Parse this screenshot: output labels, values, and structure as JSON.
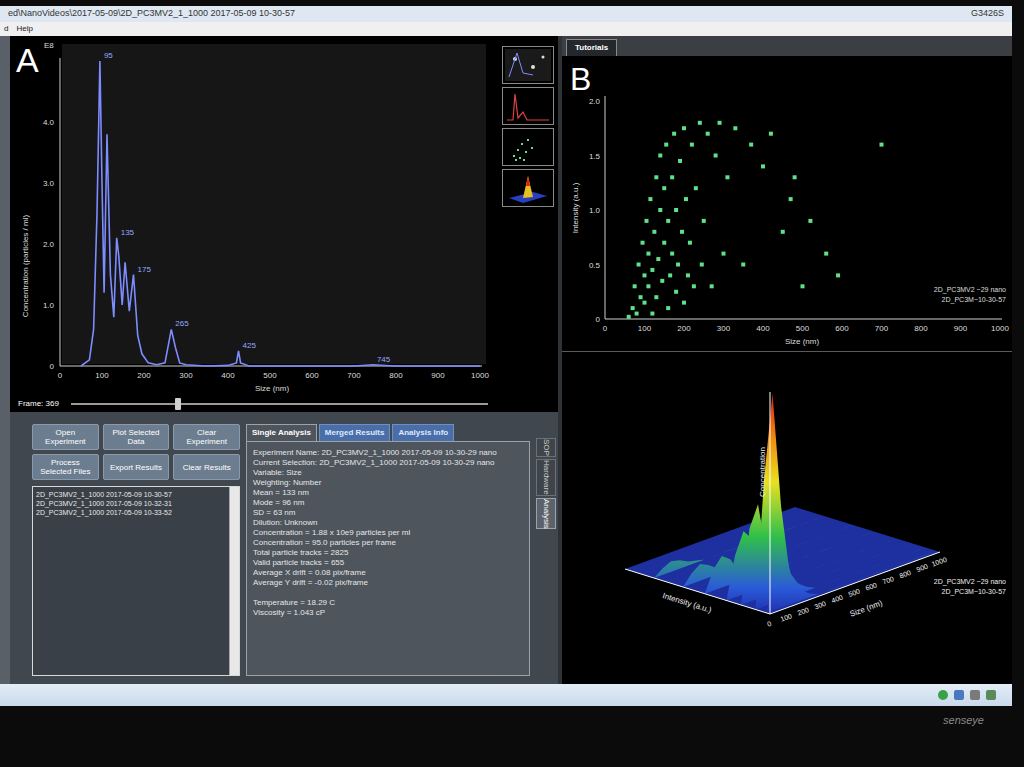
{
  "window": {
    "title": "ed\\NanoVideos\\2017-05-09\\2D_PC3MV2_1_1000 2017-05-09 10-30-57",
    "menu": [
      "d",
      "Help"
    ],
    "corner_text": "G3426S"
  },
  "panel_a": {
    "letter": "A",
    "multiplier": "E8",
    "y_label": "Concentration (particles / ml)",
    "y_ticks": [
      "0",
      "1.0",
      "2.0",
      "3.0",
      "4.0"
    ],
    "x_label": "Size (nm)",
    "x_ticks": [
      "0",
      "100",
      "200",
      "300",
      "400",
      "500",
      "600",
      "700",
      "800",
      "900",
      "1000"
    ],
    "series": {
      "size": [
        50,
        70,
        80,
        88,
        95,
        100,
        105,
        112,
        120,
        128,
        135,
        140,
        148,
        155,
        165,
        175,
        185,
        195,
        210,
        230,
        250,
        265,
        275,
        285,
        300,
        350,
        400,
        420,
        425,
        430,
        450,
        500,
        600,
        700,
        745,
        800,
        900,
        1000
      ],
      "concentration": [
        0,
        0.1,
        0.6,
        2.5,
        5.0,
        3.0,
        1.2,
        3.8,
        1.5,
        0.8,
        2.1,
        1.8,
        1.0,
        1.7,
        0.9,
        1.5,
        0.5,
        0.2,
        0.05,
        0.02,
        0.05,
        0.6,
        0.3,
        0.05,
        0.02,
        0,
        0.01,
        0.05,
        0.25,
        0.05,
        0,
        0,
        0,
        0,
        0.02,
        0,
        0,
        0
      ]
    },
    "peak_labels": [
      {
        "text": "95",
        "size": 95,
        "concentration": 5.0
      },
      {
        "text": "135",
        "size": 135,
        "concentration": 2.1
      },
      {
        "text": "175",
        "size": 175,
        "concentration": 1.5
      },
      {
        "text": "265",
        "size": 265,
        "concentration": 0.6
      },
      {
        "text": "425",
        "size": 425,
        "concentration": 0.25
      },
      {
        "text": "745",
        "size": 745,
        "concentration": 0.02
      }
    ],
    "thumbnails": [
      {
        "kind": "video"
      },
      {
        "kind": "histogram"
      },
      {
        "kind": "scatter"
      },
      {
        "kind": "surface"
      }
    ]
  },
  "frame_slider": {
    "label": "Frame: 369",
    "level": 0.25
  },
  "panel_b": {
    "letter": "B",
    "tab": "Tutorials",
    "y_label": "Intensity (a.u.)",
    "y_ticks": [
      "0",
      "0.5",
      "1.0",
      "1.5",
      "2.0"
    ],
    "x_label": "Size (nm)",
    "x_ticks": [
      "0",
      "100",
      "200",
      "300",
      "400",
      "500",
      "600",
      "700",
      "800",
      "900",
      "1000"
    ],
    "points": {
      "size": [
        60,
        70,
        75,
        80,
        85,
        90,
        95,
        100,
        100,
        105,
        110,
        110,
        115,
        120,
        120,
        125,
        130,
        130,
        135,
        140,
        140,
        145,
        150,
        150,
        155,
        160,
        160,
        165,
        170,
        170,
        175,
        180,
        180,
        185,
        190,
        195,
        200,
        200,
        205,
        210,
        215,
        220,
        225,
        230,
        240,
        245,
        250,
        260,
        270,
        280,
        290,
        300,
        310,
        330,
        350,
        370,
        400,
        420,
        450,
        470,
        480,
        500,
        520,
        560,
        590,
        700
      ],
      "intensity": [
        0.02,
        0.1,
        0.3,
        0.05,
        0.5,
        0.2,
        0.7,
        0.15,
        0.4,
        0.9,
        0.3,
        0.6,
        1.1,
        0.05,
        0.45,
        0.8,
        1.3,
        0.2,
        0.55,
        1.0,
        1.5,
        0.35,
        0.7,
        1.2,
        1.6,
        0.1,
        0.9,
        0.4,
        1.3,
        0.6,
        1.7,
        0.25,
        1.0,
        0.5,
        1.45,
        0.8,
        0.15,
        1.75,
        1.1,
        0.4,
        0.7,
        1.6,
        0.3,
        1.2,
        1.8,
        0.5,
        0.9,
        1.7,
        0.3,
        1.5,
        1.8,
        0.6,
        1.3,
        1.75,
        0.5,
        1.6,
        1.4,
        1.7,
        0.8,
        1.1,
        1.3,
        0.3,
        0.9,
        0.6,
        0.4,
        1.6
      ]
    },
    "legend": [
      "2D_PC3MV2 ~29 nano",
      "2D_PC3M~10-30-57"
    ]
  },
  "surface": {
    "z_label": "Concentration",
    "y_label": "Intensity (a.u.)",
    "x_label": "Size (nm)",
    "x_ticks": [
      "0",
      "100",
      "200",
      "300",
      "400",
      "500",
      "600",
      "700",
      "800",
      "900",
      "1000"
    ],
    "intensity": [
      1.6,
      1.2,
      0.9,
      0.6,
      0.4,
      0.2,
      0.05
    ],
    "heights": [
      [
        0,
        0.03,
        0.05,
        0.04,
        0.02,
        0.01,
        0,
        0,
        0,
        0,
        0,
        0,
        0,
        0,
        0,
        0,
        0,
        0,
        0,
        0,
        0
      ],
      [
        0,
        0.05,
        0.08,
        0.06,
        0.03,
        0.02,
        0.01,
        0,
        0,
        0,
        0,
        0,
        0,
        0,
        0,
        0,
        0,
        0,
        0,
        0,
        0
      ],
      [
        0,
        0.1,
        0.15,
        0.12,
        0.05,
        0.03,
        0.01,
        0,
        0,
        0,
        0,
        0,
        0,
        0,
        0,
        0,
        0,
        0,
        0,
        0,
        0
      ],
      [
        0,
        0.2,
        0.3,
        0.25,
        0.1,
        0.04,
        0.02,
        0,
        0,
        0,
        0,
        0,
        0,
        0,
        0,
        0,
        0,
        0,
        0,
        0,
        0
      ],
      [
        0,
        0.35,
        0.45,
        0.2,
        0.08,
        0.03,
        0.01,
        0,
        0,
        0,
        0,
        0,
        0,
        0,
        0,
        0,
        0,
        0,
        0,
        0,
        0
      ],
      [
        0,
        0.6,
        1.0,
        0.45,
        0.12,
        0.05,
        0.02,
        0,
        0,
        0,
        0,
        0,
        0,
        0,
        0,
        0,
        0,
        0,
        0,
        0,
        0
      ],
      [
        0,
        0.15,
        0.3,
        0.12,
        0.05,
        0.02,
        0,
        0,
        0,
        0,
        0,
        0,
        0,
        0,
        0,
        0,
        0,
        0,
        0,
        0,
        0
      ]
    ],
    "legend": [
      "2D_PC3MV2 ~29 nano",
      "2D_PC3M~10-30-57"
    ]
  },
  "buttons": [
    "Open Experiment",
    "Plot Selected Data",
    "Clear Experiment",
    "Process Selected Files",
    "Export Results",
    "Clear Results"
  ],
  "files": [
    "2D_PC3MV2_1_1000 2017-05-09 10-30-57",
    "2D_PC3MV2_1_1000 2017-05-09 10-32-31",
    "2D_PC3MV2_1_1000 2017-05-09 10-33-52"
  ],
  "tabs": [
    {
      "label": "Single Analysis",
      "selected": true
    },
    {
      "label": "Merged Results",
      "selected": false
    },
    {
      "label": "Analysis Info",
      "selected": false
    }
  ],
  "side_tabs": [
    {
      "label": "SOP",
      "selected": false
    },
    {
      "label": "Hardware",
      "selected": false
    },
    {
      "label": "Analysis",
      "selected": true
    }
  ],
  "analysis_lines": [
    "Experiment Name: 2D_PC3MV2_1_1000 2017-05-09 10-30-29 nano",
    "Current Selection: 2D_PC3MV2_1_1000 2017-05-09 10-30-29 nano",
    "Variable: Size",
    "Weighting: Number",
    "Mean = 133 nm",
    "Mode = 96 nm",
    "SD = 63 nm",
    "Dilution: Unknown",
    "Concentration = 1.88 x 10e9 particles per ml",
    "Concentration = 95.0 particles per frame",
    "Total particle tracks = 2825",
    "Valid particle tracks = 655",
    "Average X drift = 0.08 pix/frame",
    "Average Y drift = -0.02 pix/frame"
  ],
  "conditions_lines": [
    "Temperature = 18.29 C",
    "Viscosity = 1.043 cP"
  ],
  "monitor_brand": "senseye"
}
